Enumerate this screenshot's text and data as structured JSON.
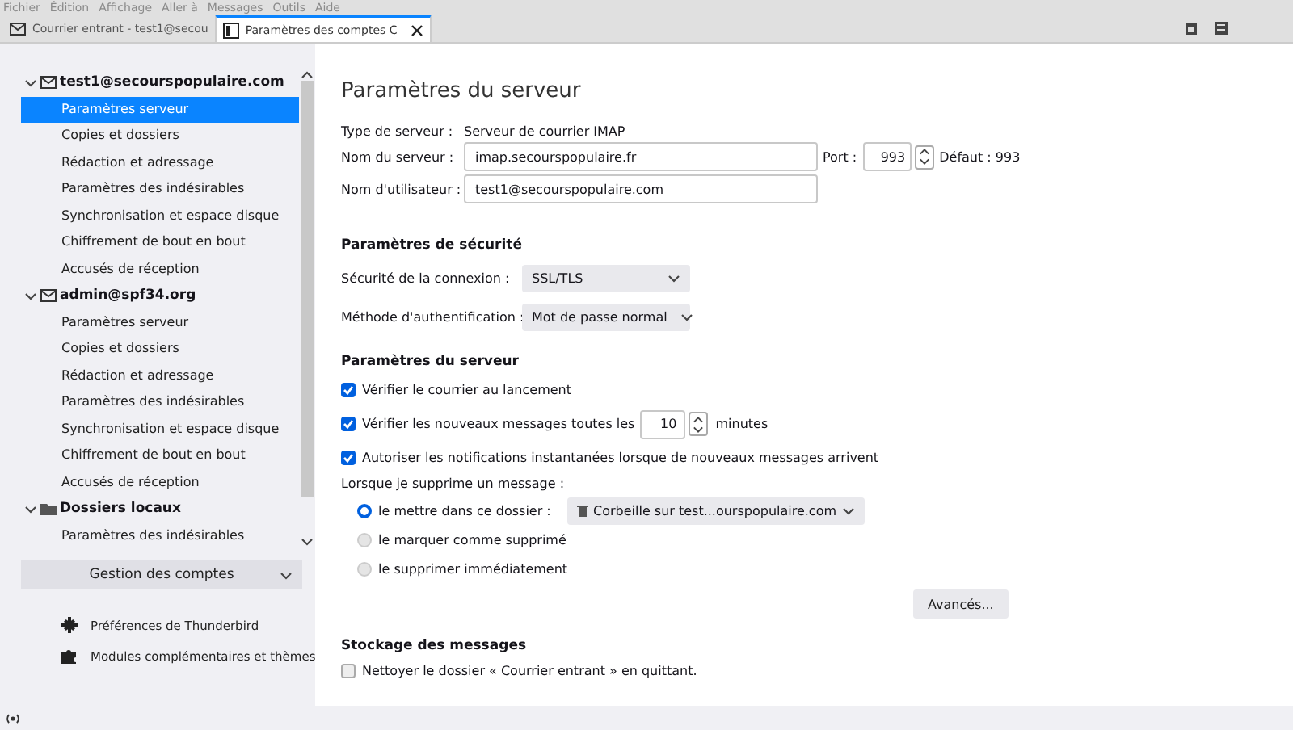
{
  "menu": [
    "Fichier",
    "Édition",
    "Affichage",
    "Aller à",
    "Messages",
    "Outils",
    "Aide"
  ],
  "tabs": [
    {
      "label": "Courrier entrant - test1@secou",
      "selected": false,
      "kind": "mail"
    },
    {
      "label": "Paramètres des comptes C",
      "selected": true,
      "kind": "settings"
    }
  ],
  "accounts": [
    {
      "name": "test1@secourspopulaire.com",
      "kind": "mail",
      "expanded": true,
      "children": [
        {
          "label": "Paramètres serveur",
          "selected": true
        },
        {
          "label": "Copies et dossiers",
          "selected": false
        },
        {
          "label": "Rédaction et adressage",
          "selected": false
        },
        {
          "label": "Paramètres des indésirables",
          "selected": false
        },
        {
          "label": "Synchronisation et espace disque",
          "selected": false
        },
        {
          "label": "Chiffrement de bout en bout",
          "selected": false
        },
        {
          "label": "Accusés de réception",
          "selected": false
        }
      ]
    },
    {
      "name": "admin@spf34.org",
      "kind": "mail",
      "expanded": true,
      "children": [
        {
          "label": "Paramètres serveur",
          "selected": false
        },
        {
          "label": "Copies et dossiers",
          "selected": false
        },
        {
          "label": "Rédaction et adressage",
          "selected": false
        },
        {
          "label": "Paramètres des indésirables",
          "selected": false
        },
        {
          "label": "Synchronisation et espace disque",
          "selected": false
        },
        {
          "label": "Chiffrement de bout en bout",
          "selected": false
        },
        {
          "label": "Accusés de réception",
          "selected": false
        }
      ]
    },
    {
      "name": "Dossiers locaux",
      "kind": "folder",
      "expanded": true,
      "children": [
        {
          "label": "Paramètres des indésirables",
          "selected": false
        }
      ]
    }
  ],
  "account_button": "Gestion des comptes",
  "links": [
    {
      "label": "Préférences de Thunderbird",
      "kind": "gear"
    },
    {
      "label": "Modules complémentaires et thèmes",
      "kind": "puzzle"
    }
  ],
  "page": {
    "title": "Paramètres du serveur",
    "server_type_label": "Type de serveur :",
    "server_type": "Serveur de courrier IMAP",
    "server_name_label": "Nom du serveur :",
    "server_name": "imap.secourspopulaire.fr",
    "port_label": "Port :",
    "port": "993",
    "default_port": "Défaut : 993",
    "username_label": "Nom d'utilisateur :",
    "username": "test1@secourspopulaire.com",
    "security": {
      "heading": "Paramètres de sécurité",
      "fields": [
        {
          "label": "Sécurité de la connexion :",
          "value": "SSL/TLS"
        },
        {
          "label": "Méthode d'authentification :",
          "value": "Mot de passe normal"
        }
      ]
    },
    "server": {
      "heading": "Paramètres du serveur",
      "checks": [
        {
          "kind": "plain",
          "label": "Vérifier le courrier au lancement",
          "checked": true
        },
        {
          "kind": "interval",
          "label": "Vérifier les nouveaux messages toutes les",
          "value": "10",
          "suffix": "minutes",
          "checked": true
        },
        {
          "kind": "plain",
          "label": "Autoriser les notifications instantanées lorsque de nouveaux messages arrivent",
          "checked": true
        }
      ],
      "delete_label": "Lorsque je supprime un message :",
      "delete_options": [
        {
          "label": "le mettre dans ce dossier :",
          "selected": true,
          "folder": "Corbeille sur test...ourspopulaire.com"
        },
        {
          "label": "le marquer comme supprimé",
          "selected": false
        },
        {
          "label": "le supprimer immédiatement",
          "selected": false
        }
      ],
      "advanced": "Avancés..."
    },
    "storage": {
      "heading": "Stockage des messages",
      "checks": [
        {
          "label": "Nettoyer le dossier « Courrier entrant » en quittant.",
          "checked": false
        }
      ]
    }
  }
}
